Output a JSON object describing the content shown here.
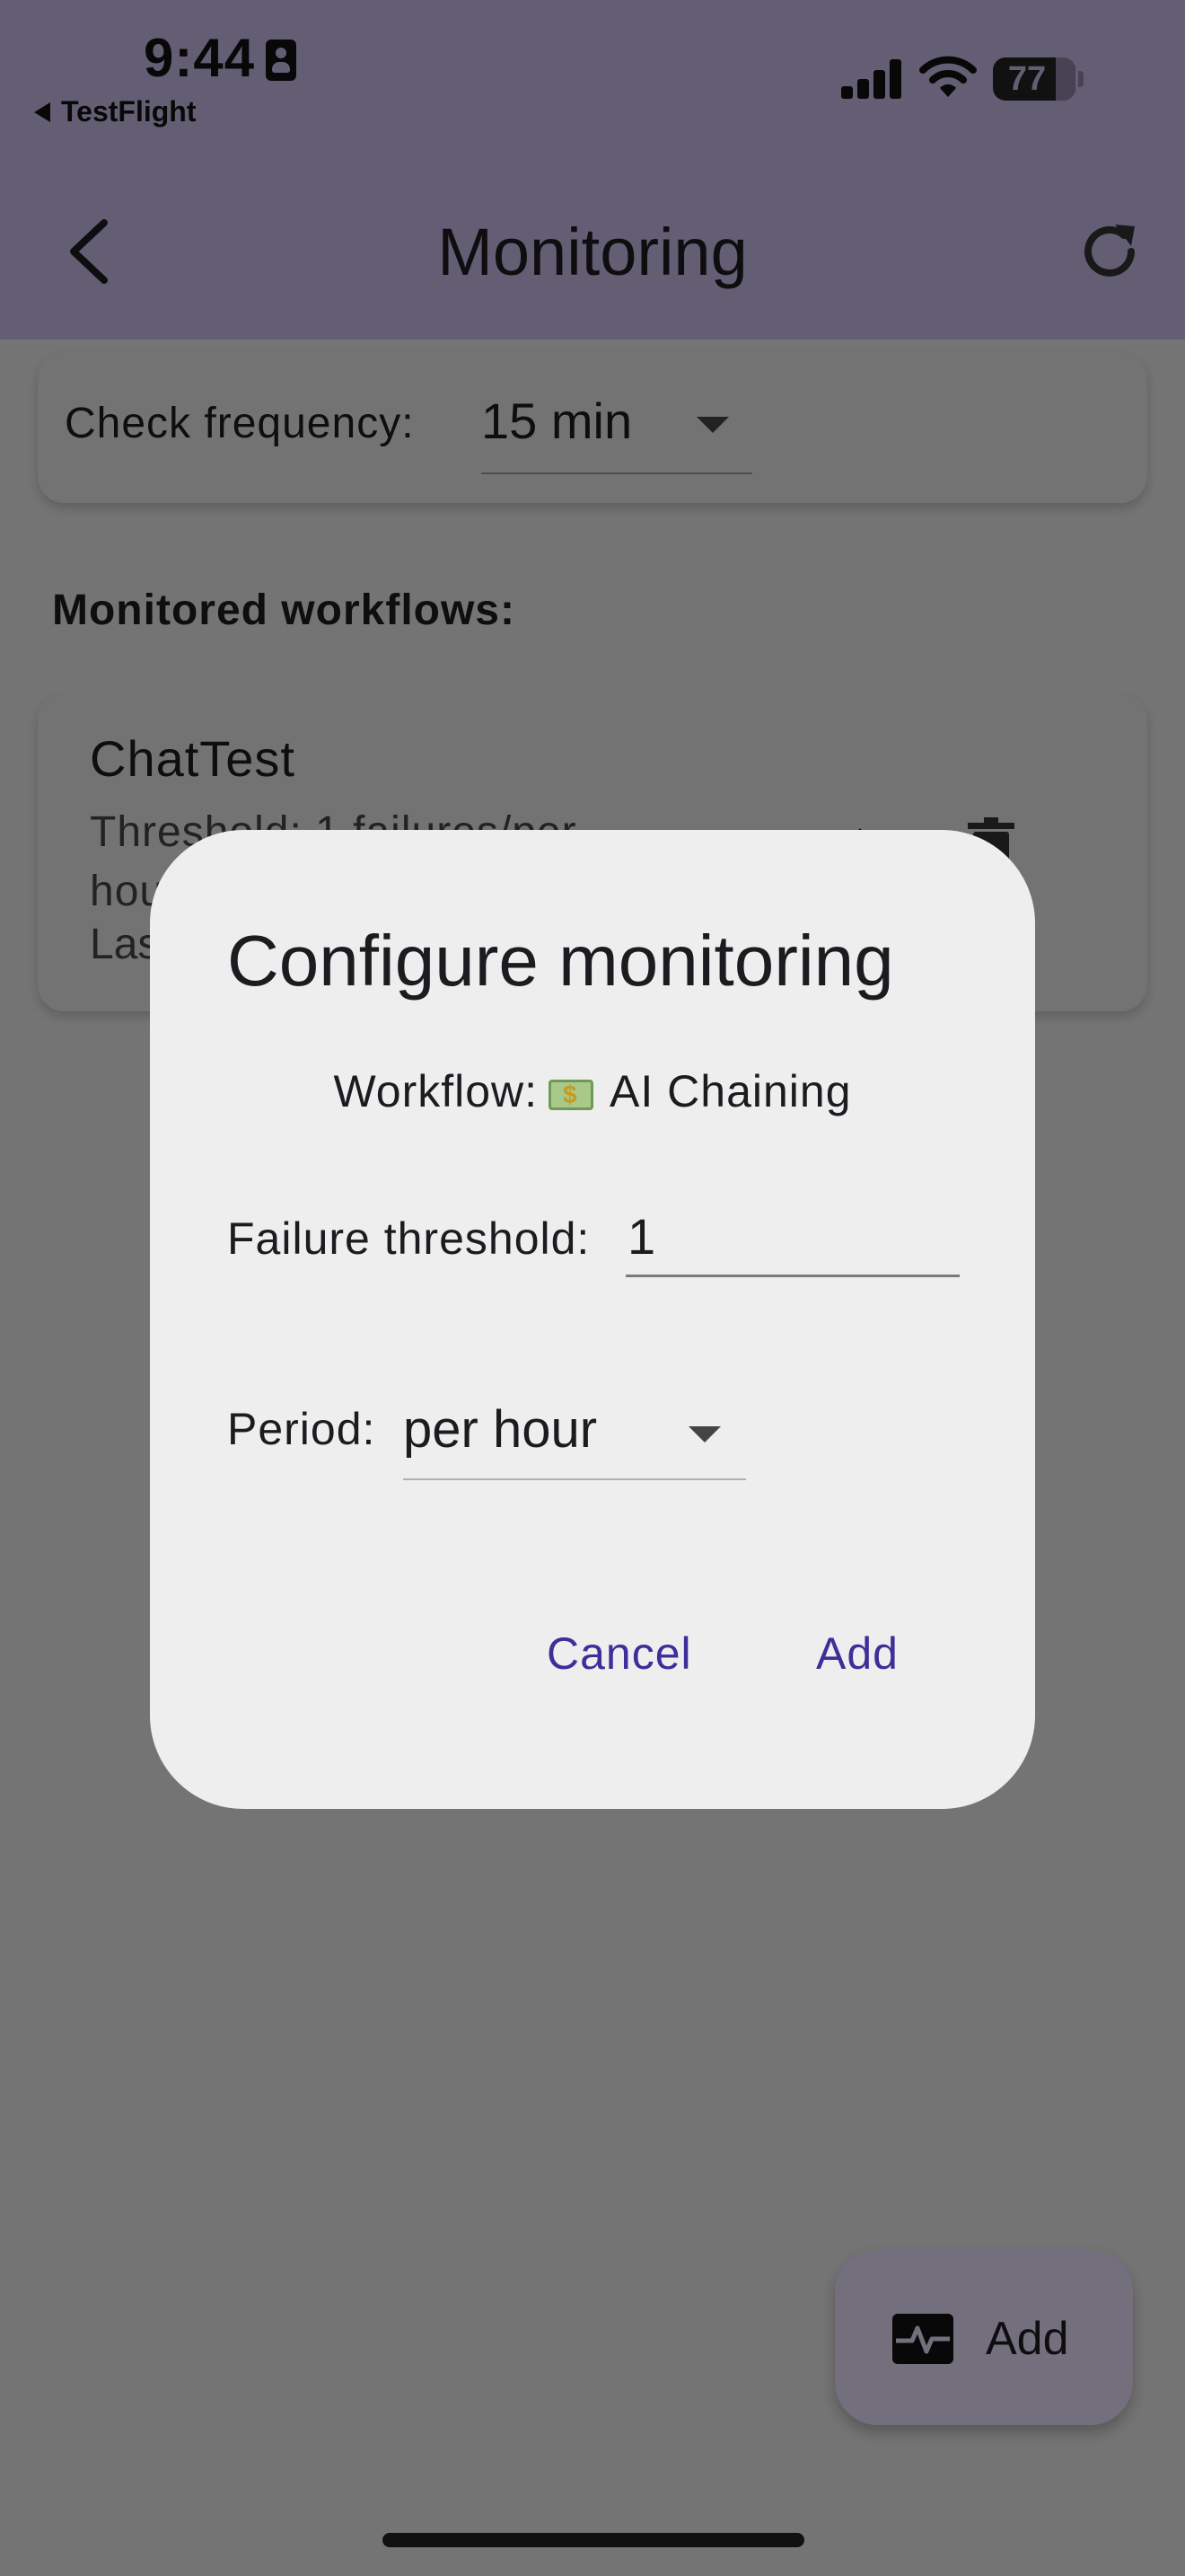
{
  "status_bar": {
    "time": "9:44",
    "back_app": "TestFlight",
    "battery": "77"
  },
  "nav": {
    "title": "Monitoring",
    "back_icon": "chevron-left-icon",
    "refresh_icon": "refresh-icon"
  },
  "frequency": {
    "label": "Check frequency:",
    "value": "15 min"
  },
  "monitored": {
    "title": "Monitored workflows:",
    "items": [
      {
        "name": "ChatTest",
        "threshold": "Threshold: 1 failures/per hour",
        "last": "Las"
      }
    ]
  },
  "fab": {
    "label": "Add",
    "icon": "monitor-heart-icon"
  },
  "dialog": {
    "title": "Configure monitoring",
    "workflow_prefix": "Workflow:",
    "workflow_icon": "money-icon",
    "workflow_name": "AI Chaining",
    "threshold_label": "Failure threshold:",
    "threshold_value": "1",
    "period_label": "Period:",
    "period_value": "per hour",
    "cancel_label": "Cancel",
    "add_label": "Add"
  },
  "colors": {
    "header": "#c7bde6",
    "accent": "#3f2d9a",
    "fab": "#e8def8"
  }
}
